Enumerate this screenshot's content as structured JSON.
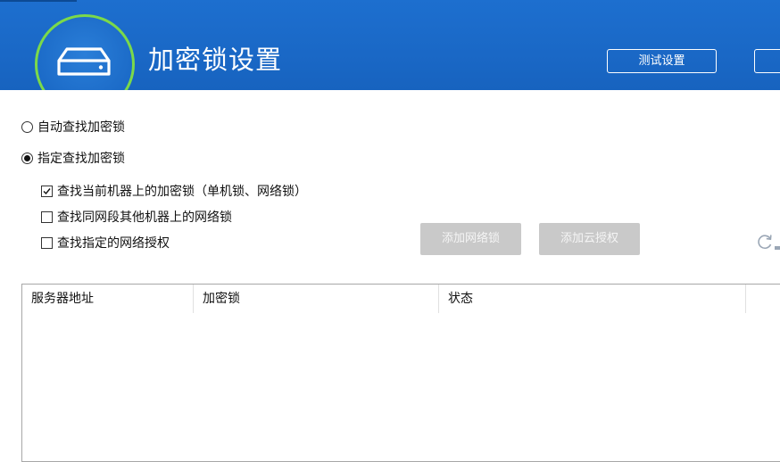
{
  "header": {
    "title": "加密锁设置",
    "test_button_label": "测试设置",
    "bg_color": "#1a68c6",
    "ring_color": "#7bd94a",
    "logo_icon": "drive-icon"
  },
  "options": {
    "auto_find": {
      "label": "自动查找加密锁",
      "selected": false
    },
    "specify_find": {
      "label": "指定查找加密锁",
      "selected": true
    },
    "checks": [
      {
        "label": "查找当前机器上的加密锁（单机锁、网络锁）",
        "checked": true
      },
      {
        "label": "查找同网段其他机器上的网络锁",
        "checked": false
      },
      {
        "label": "查找指定的网络授权",
        "checked": false
      }
    ]
  },
  "actions": {
    "add_network_lock": "添加网络锁",
    "add_cloud_auth": "添加云授权",
    "refresh_icon": "refresh-icon"
  },
  "table": {
    "columns": [
      "服务器地址",
      "加密锁",
      "状态"
    ],
    "rows": []
  }
}
